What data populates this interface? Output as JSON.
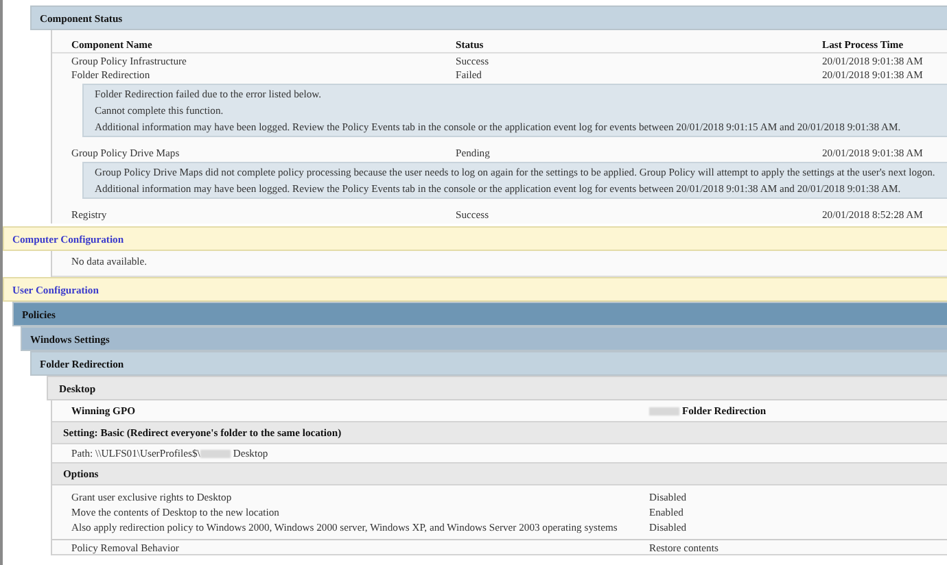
{
  "component_status": {
    "title": "Component Status",
    "columns": [
      "Component Name",
      "Status",
      "Last Process Time"
    ],
    "rows": [
      {
        "name": "Group Policy Infrastructure",
        "status": "Success",
        "time": "20/01/2018 9:01:38 AM",
        "details": []
      },
      {
        "name": "Folder Redirection",
        "status": "Failed",
        "time": "20/01/2018 9:01:38 AM",
        "details": [
          "Folder Redirection failed due to the error listed below.",
          "Cannot complete this function.",
          "Additional information may have been logged. Review the Policy Events tab in the console or the application event log for events between 20/01/2018 9:01:15 AM and 20/01/2018 9:01:38 AM."
        ]
      },
      {
        "name": "Group Policy Drive Maps",
        "status": "Pending",
        "time": "20/01/2018 9:01:38 AM",
        "details": [
          "Group Policy Drive Maps did not complete policy processing because the user needs to log on again for the settings to be applied. Group Policy will attempt to apply the settings at the user's next logon.",
          "Additional information may have been logged. Review the Policy Events tab in the console or the application event log for events between 20/01/2018 9:01:38 AM and 20/01/2018 9:01:38 AM."
        ]
      },
      {
        "name": "Registry",
        "status": "Success",
        "time": "20/01/2018 8:52:28 AM",
        "details": []
      }
    ]
  },
  "computer_configuration": {
    "title": "Computer Configuration",
    "message": "No data available."
  },
  "user_configuration": {
    "title": "User Configuration",
    "levels": [
      "Policies",
      "Windows Settings",
      "Folder Redirection"
    ],
    "desktop": {
      "title": "Desktop",
      "winning_gpo": {
        "label": "Winning GPO",
        "value": "Folder Redirection"
      },
      "setting": {
        "title": "Setting: Basic (Redirect everyone's folder to the same location)",
        "path_prefix": "Path: \\\\ULFS01\\UserProfiles$\\",
        "path_suffix": "Desktop"
      },
      "options": {
        "title": "Options",
        "rows": [
          {
            "name": "Grant user exclusive rights to Desktop",
            "value": "Disabled"
          },
          {
            "name": "Move the contents of Desktop to the new location",
            "value": "Enabled"
          },
          {
            "name": "Also apply redirection policy to Windows 2000, Windows 2000 server, Windows XP, and Windows Server 2003 operating systems",
            "value": "Disabled"
          }
        ]
      },
      "policy_removal": {
        "name": "Policy Removal Behavior",
        "value": "Restore contents"
      }
    }
  }
}
